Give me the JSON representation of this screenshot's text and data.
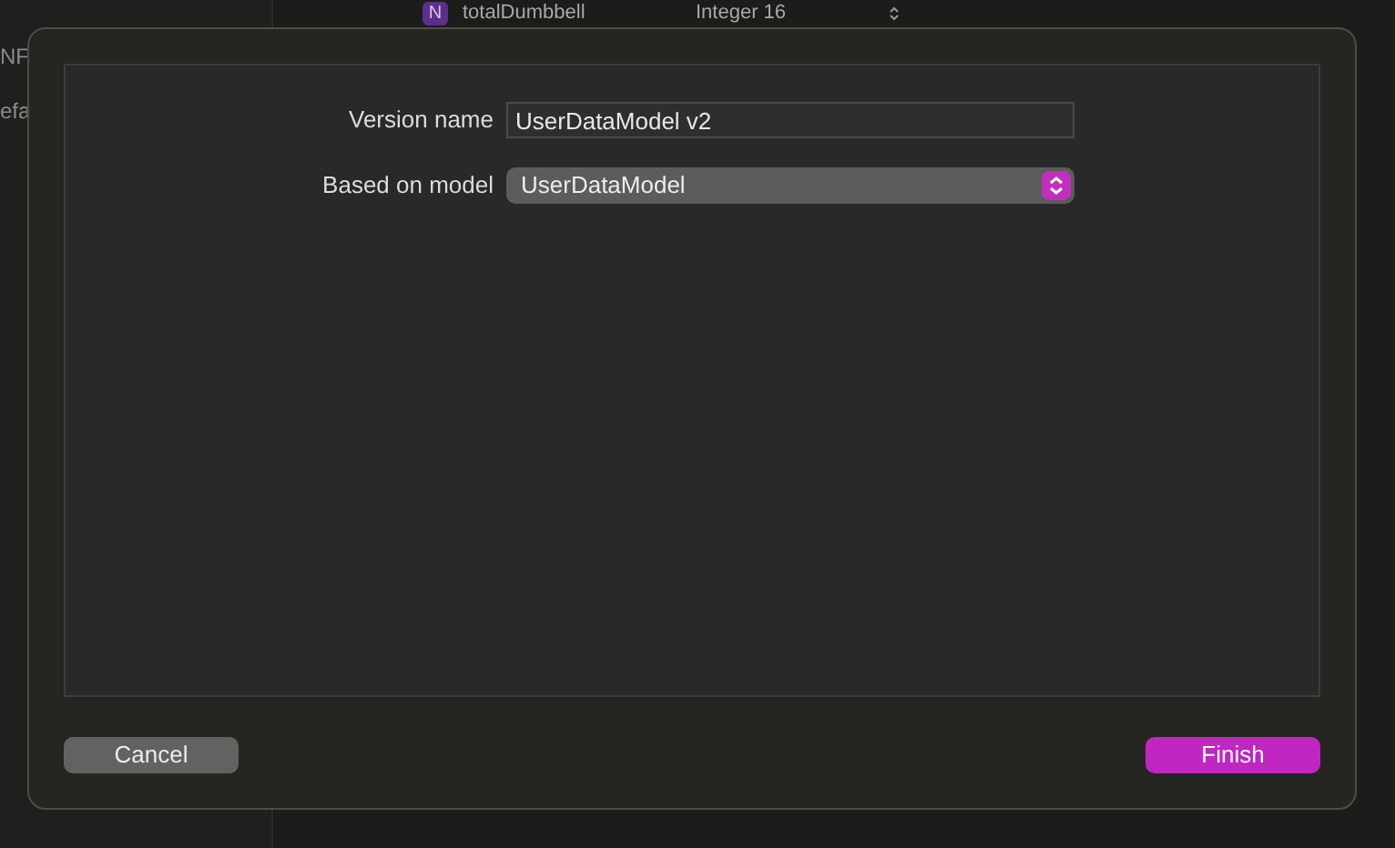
{
  "background": {
    "sidebar_texts": [
      "NF",
      "efa"
    ],
    "attribute_row": {
      "badge": "N",
      "name": "totalDumbbell",
      "type": "Integer 16"
    }
  },
  "dialog": {
    "fields": [
      {
        "kind": "text",
        "label": "Version name",
        "value": "UserDataModel v2"
      },
      {
        "kind": "select",
        "label": "Based on model",
        "value": "UserDataModel"
      }
    ],
    "buttons": [
      {
        "label": "Cancel",
        "kind": "secondary"
      },
      {
        "label": "Finish",
        "kind": "primary"
      }
    ]
  }
}
